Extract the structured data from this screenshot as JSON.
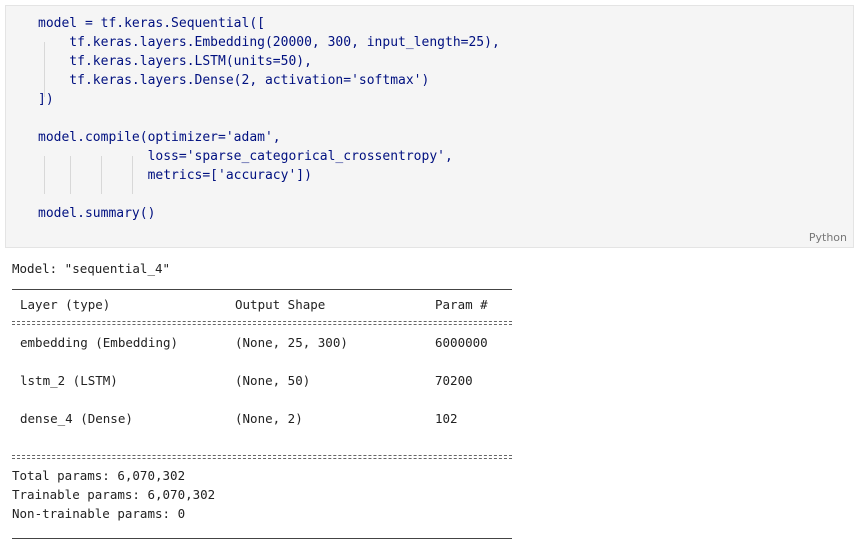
{
  "code_cell": {
    "language_label": "Python",
    "lines": [
      "model = tf.keras.Sequential([",
      "    tf.keras.layers.Embedding(20000, 300, input_length=25),",
      "    tf.keras.layers.LSTM(units=50),",
      "    tf.keras.layers.Dense(2, activation='softmax')",
      "])",
      "",
      "model.compile(optimizer='adam',",
      "              loss='sparse_categorical_crossentropy',",
      "              metrics=['accuracy'])",
      "",
      "model.summary()"
    ]
  },
  "summary": {
    "model_line": "Model: \"sequential_4\"",
    "headers": [
      "Layer (type)",
      "Output Shape",
      "Param #"
    ],
    "rows": [
      [
        "embedding (Embedding)",
        "(None, 25, 300)",
        "6000000"
      ],
      [
        "lstm_2 (LSTM)",
        "(None, 50)",
        "70200"
      ],
      [
        "dense_4 (Dense)",
        "(None, 2)",
        "102"
      ]
    ],
    "total": "Total params: 6,070,302",
    "trainable": "Trainable params: 6,070,302",
    "non_trainable": "Non-trainable params: 0"
  }
}
